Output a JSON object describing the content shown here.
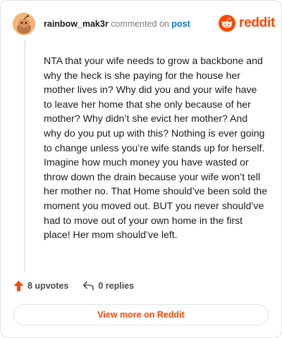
{
  "comment": {
    "username": "rainbow_mak3r",
    "verb": "commented on",
    "post_link": "post",
    "avatar_icon": "reddit-snoo-avatar-icon",
    "text": "NTA that your wife needs to grow a backbone and why the heck is she paying for the house her mother lives in? Why did you and your wife have to leave her home that she only because of her mother? Why didn’t she evict her mother? And why do you put up with this? Nothing is ever going to change unless you’re wife stands up for herself. Imagine how much money you have wasted or throw down the drain because your wife won’t tell her mother no. That Home should’ve been sold the moment you moved out. BUT you never should’ve had to move out of your own home in the first place! Her mom should’ve left."
  },
  "brand": {
    "name": "reddit",
    "icon": "reddit-logo-icon",
    "color": "#ff4500"
  },
  "actions": {
    "upvotes_label": "8 upvotes",
    "upvote_icon": "upvote-arrow-icon",
    "upvote_color": "#ff4500",
    "replies_label": "0 replies",
    "reply_icon": "reply-arrow-icon"
  },
  "footer": {
    "view_more_label": "View more on Reddit"
  }
}
